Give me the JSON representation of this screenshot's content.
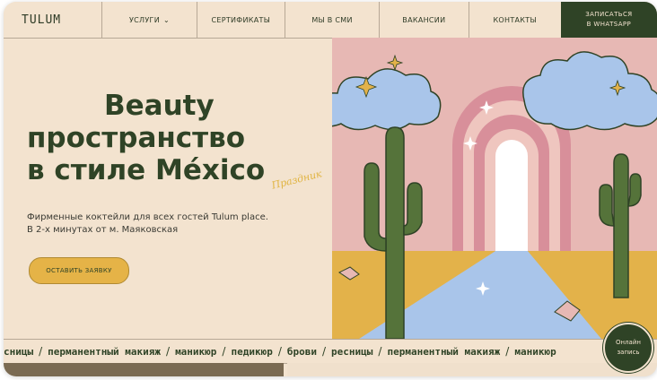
{
  "nav": {
    "logo": "TULUM",
    "items": [
      "УСЛУГИ",
      "СЕРТИФИКАТЫ",
      "МЫ В СМИ",
      "ВАКАНСИИ",
      "КОНТАКТЫ"
    ],
    "cta_line1": "ЗАПИСАТЬСЯ",
    "cta_line2": "В WHATSAPP"
  },
  "hero": {
    "title_line1": "Beauty",
    "title_line2": "пространство",
    "title_line3": "в стиле México",
    "script": "Праздник",
    "subtitle_line1": "Фирменные коктейли для всех гостей Tulum place.",
    "subtitle_line2": "В 2-х минутах от м. Маяковская",
    "button": "ОСТАВИТЬ ЗАЯВКУ"
  },
  "marquee": {
    "words": [
      "сницы",
      "перманентный макияж",
      "маникюр",
      "педикюр",
      "брови",
      "ресницы",
      "перманентный макияж",
      "маникюр"
    ]
  },
  "online": {
    "line1": "Онлайн",
    "line2": "запись"
  },
  "colors": {
    "background": "#f3e3cf",
    "brand_green": "#2f4326",
    "accent_yellow": "#e5b347",
    "pink": "#e7b8b4",
    "sky_cloud": "#a9c5ea"
  }
}
